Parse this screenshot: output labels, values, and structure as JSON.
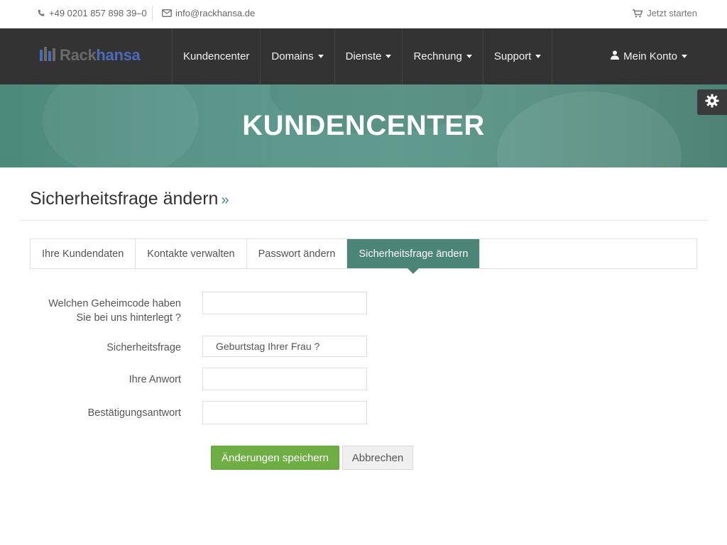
{
  "topbar": {
    "phone": "+49 0201 857 898 39–0",
    "email": "info@rackhansa.de",
    "start_label": "Jetzt starten"
  },
  "logo": {
    "part1": "Rack",
    "part2": "hansa"
  },
  "nav": {
    "items": [
      {
        "label": "Kundencenter",
        "dropdown": false
      },
      {
        "label": "Domains",
        "dropdown": true
      },
      {
        "label": "Dienste",
        "dropdown": true
      },
      {
        "label": "Rechnung",
        "dropdown": true
      },
      {
        "label": "Support",
        "dropdown": true
      }
    ],
    "account_label": "Mein Konto"
  },
  "banner": {
    "title": "KUNDENCENTER"
  },
  "page": {
    "title": "Sicherheitsfrage ändern",
    "title_suffix": "»"
  },
  "tabs": [
    {
      "label": "Ihre Kundendaten",
      "active": false
    },
    {
      "label": "Kontakte verwalten",
      "active": false
    },
    {
      "label": "Passwort ändern",
      "active": false
    },
    {
      "label": "Sicherheitsfrage ändern",
      "active": true
    }
  ],
  "form": {
    "secret_code": {
      "label_line1": "Welchen Geheimcode haben",
      "label_line2": "Sie bei uns hinterlegt ?",
      "value": ""
    },
    "question": {
      "label": "Sicherheitsfrage",
      "value": "Geburtstag Ihrer Frau ?"
    },
    "answer": {
      "label": "Ihre Anwort",
      "value": ""
    },
    "confirm": {
      "label": "Bestätigungsantwort",
      "value": ""
    },
    "save_label": "Änderungen speichern",
    "cancel_label": "Abbrechen"
  },
  "colors": {
    "nav_bg": "#333333",
    "banner": "#5a968a",
    "active_tab": "#4a8578",
    "save_button": "#6fad45",
    "logo_accent": "#4a6bb8"
  },
  "icons": {
    "phone": "phone-icon",
    "email": "envelope-icon",
    "cart": "cart-icon",
    "user": "user-icon",
    "settings": "gear-icon"
  }
}
